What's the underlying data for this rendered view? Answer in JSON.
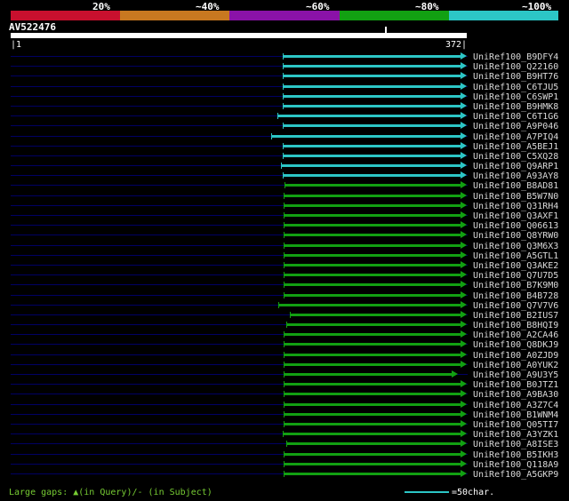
{
  "chart_data": {
    "type": "bar",
    "orientation": "horizontal",
    "title": "AV522476",
    "x_axis": {
      "min": 1,
      "max": 372,
      "start_label": "|1",
      "end_label": "372|"
    },
    "legend_position": "top",
    "grid": false,
    "identity_scale": [
      {
        "label": "20%",
        "color": "#c8102e"
      },
      {
        "label": "~40%",
        "color": "#c87820"
      },
      {
        "label": "~60%",
        "color": "#8a12a8"
      },
      {
        "label": "~80%",
        "color": "#12a012"
      },
      {
        "label": "~100%",
        "color": "#2cc6c6"
      }
    ],
    "hits": [
      {
        "id": "UniRef100_B9DFY4",
        "identity": "~100%",
        "q_start": 222,
        "q_end": 372
      },
      {
        "id": "UniRef100_Q22160",
        "identity": "~100%",
        "q_start": 222,
        "q_end": 372
      },
      {
        "id": "UniRef100_B9HT76",
        "identity": "~100%",
        "q_start": 222,
        "q_end": 372
      },
      {
        "id": "UniRef100_C6TJU5",
        "identity": "~100%",
        "q_start": 222,
        "q_end": 372
      },
      {
        "id": "UniRef100_C6SWP1",
        "identity": "~100%",
        "q_start": 222,
        "q_end": 372
      },
      {
        "id": "UniRef100_B9HMK8",
        "identity": "~100%",
        "q_start": 222,
        "q_end": 372
      },
      {
        "id": "UniRef100_C6T1G6",
        "identity": "~100%",
        "q_start": 218,
        "q_end": 372
      },
      {
        "id": "UniRef100_A9P046",
        "identity": "~100%",
        "q_start": 222,
        "q_end": 372
      },
      {
        "id": "UniRef100_A7PIQ4",
        "identity": "~100%",
        "q_start": 213,
        "q_end": 372
      },
      {
        "id": "UniRef100_A5BEJ1",
        "identity": "~100%",
        "q_start": 222,
        "q_end": 372
      },
      {
        "id": "UniRef100_C5XQ28",
        "identity": "~100%",
        "q_start": 222,
        "q_end": 372
      },
      {
        "id": "UniRef100_Q9ARP1",
        "identity": "~100%",
        "q_start": 221,
        "q_end": 372
      },
      {
        "id": "UniRef100_A93AY8",
        "identity": "~100%",
        "q_start": 222,
        "q_end": 372
      },
      {
        "id": "UniRef100_B8AD81",
        "identity": "~80%",
        "q_start": 224,
        "q_end": 372
      },
      {
        "id": "UniRef100_B5W7N0",
        "identity": "~80%",
        "q_start": 223,
        "q_end": 372
      },
      {
        "id": "UniRef100_Q31RH4",
        "identity": "~80%",
        "q_start": 223,
        "q_end": 372
      },
      {
        "id": "UniRef100_Q3AXF1",
        "identity": "~80%",
        "q_start": 223,
        "q_end": 372
      },
      {
        "id": "UniRef100_Q06613",
        "identity": "~80%",
        "q_start": 223,
        "q_end": 372
      },
      {
        "id": "UniRef100_Q8YRW0",
        "identity": "~80%",
        "q_start": 223,
        "q_end": 372
      },
      {
        "id": "UniRef100_Q3M6X3",
        "identity": "~80%",
        "q_start": 223,
        "q_end": 372
      },
      {
        "id": "UniRef100_A5GTL1",
        "identity": "~80%",
        "q_start": 223,
        "q_end": 372
      },
      {
        "id": "UniRef100_Q3AKE2",
        "identity": "~80%",
        "q_start": 223,
        "q_end": 372
      },
      {
        "id": "UniRef100_Q7U7D5",
        "identity": "~80%",
        "q_start": 223,
        "q_end": 372
      },
      {
        "id": "UniRef100_B7K9M0",
        "identity": "~80%",
        "q_start": 223,
        "q_end": 372
      },
      {
        "id": "UniRef100_B4B728",
        "identity": "~80%",
        "q_start": 223,
        "q_end": 372
      },
      {
        "id": "UniRef100_Q7V7V6",
        "identity": "~80%",
        "q_start": 219,
        "q_end": 372
      },
      {
        "id": "UniRef100_B2IUS7",
        "identity": "~80%",
        "q_start": 228,
        "q_end": 372
      },
      {
        "id": "UniRef100_B8HQI9",
        "identity": "~80%",
        "q_start": 225,
        "q_end": 372
      },
      {
        "id": "UniRef100_A2CA46",
        "identity": "~80%",
        "q_start": 223,
        "q_end": 372
      },
      {
        "id": "UniRef100_Q8DKJ9",
        "identity": "~80%",
        "q_start": 223,
        "q_end": 372
      },
      {
        "id": "UniRef100_A0ZJD9",
        "identity": "~80%",
        "q_start": 223,
        "q_end": 372
      },
      {
        "id": "UniRef100_A0YUK2",
        "identity": "~80%",
        "q_start": 223,
        "q_end": 372
      },
      {
        "id": "UniRef100_A9U3Y5",
        "identity": "~80%",
        "q_start": 223,
        "q_end": 365
      },
      {
        "id": "UniRef100_B0JTZ1",
        "identity": "~80%",
        "q_start": 223,
        "q_end": 372
      },
      {
        "id": "UniRef100_A9BA30",
        "identity": "~80%",
        "q_start": 223,
        "q_end": 372
      },
      {
        "id": "UniRef100_A3Z7C4",
        "identity": "~80%",
        "q_start": 223,
        "q_end": 372
      },
      {
        "id": "UniRef100_B1WNM4",
        "identity": "~80%",
        "q_start": 223,
        "q_end": 372
      },
      {
        "id": "UniRef100_Q05TI7",
        "identity": "~80%",
        "q_start": 223,
        "q_end": 372
      },
      {
        "id": "UniRef100_A3YZK1",
        "identity": "~80%",
        "q_start": 222,
        "q_end": 372
      },
      {
        "id": "UniRef100_A8ISE3",
        "identity": "~80%",
        "q_start": 225,
        "q_end": 372
      },
      {
        "id": "UniRef100_B5IKH3",
        "identity": "~80%",
        "q_start": 223,
        "q_end": 372
      },
      {
        "id": "UniRef100_Q118A9",
        "identity": "~80%",
        "q_start": 223,
        "q_end": 372
      },
      {
        "id": "UniRef100_A5GKP9",
        "identity": "~80%",
        "q_start": 223,
        "q_end": 372
      }
    ]
  },
  "footer": {
    "gaps_note": "Large gaps: ▲(in Query)/- (in Subject)",
    "scale_legend": "=50char."
  },
  "colors": {
    "background": "#000000",
    "baseline": "#000064",
    "query_bar": "#ffffff",
    "hit_label_text": "#d9d9d9",
    "footer_note_text": "#77cc33",
    "legend_line": "#2cc6c6"
  }
}
